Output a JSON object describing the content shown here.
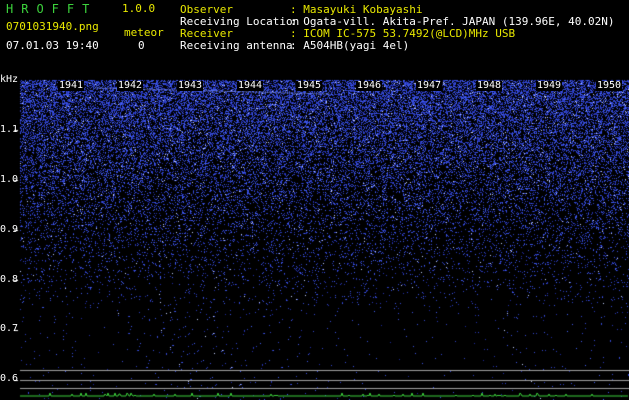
{
  "header": {
    "app_title": "HROFFT",
    "app_version": "1.0.0",
    "file_name": "0701031940.png",
    "date_time": "07.01.03 19:40",
    "meteor_label": "meteor",
    "meteor_count": "0",
    "info": [
      {
        "key": "Observer",
        "value": ": Masayuki Kobayashi"
      },
      {
        "key": "Receiving Location",
        "value": ": Ogata-vill. Akita-Pref. JAPAN (139.96E, 40.02N)"
      },
      {
        "key": "Receiver",
        "value": ": ICOM IC-575 53.7492(@LCD)MHz USB"
      },
      {
        "key": "Receiving antenna",
        "value": ": A504HB(yagi 4el)"
      }
    ]
  },
  "spectrogram": {
    "y_unit": "kHz",
    "y_ticks": [
      "1.1",
      "1.0",
      "0.9",
      "0.8",
      "0.7",
      "0.6"
    ],
    "x_ticks": [
      "1941",
      "1942",
      "1943",
      "1944",
      "1945",
      "1946",
      "1947",
      "1948",
      "1949",
      "1950"
    ],
    "colors": {
      "noise": "#2a40ff",
      "text_header": "#e8e800",
      "grid": "#a0a0a0",
      "axis": "#3cd23c"
    }
  }
}
